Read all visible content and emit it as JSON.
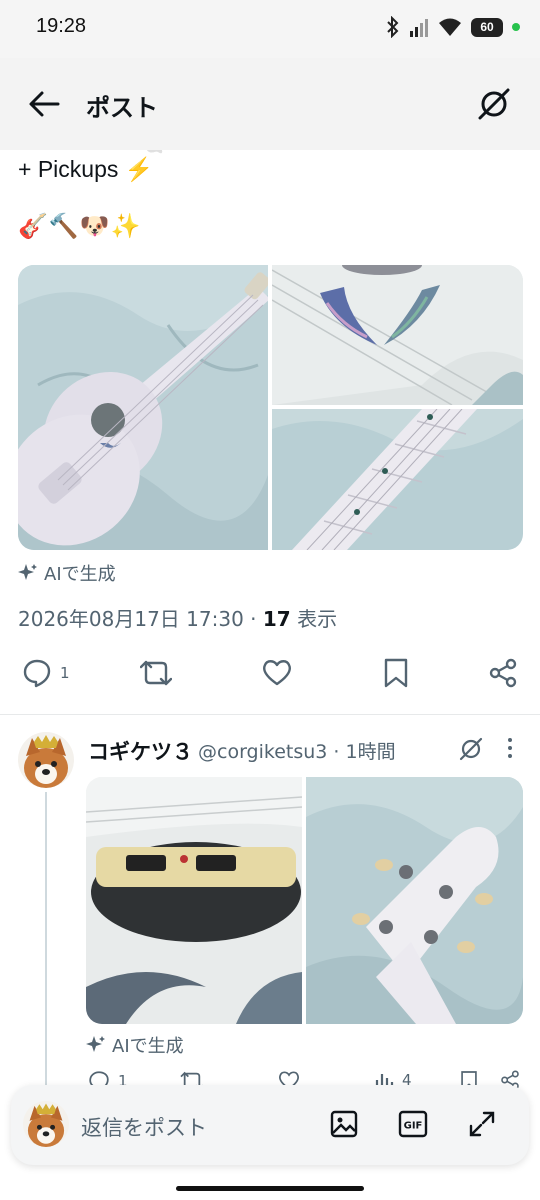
{
  "status_bar": {
    "time": "19:28",
    "battery": "60",
    "icons": [
      "bluetooth-icon",
      "signal-icon",
      "wifi-icon",
      "battery-icon",
      "green-dot-indicator"
    ]
  },
  "header": {
    "title": "ポスト",
    "back_icon": "arrow-left-icon",
    "grok_icon": "grok-icon"
  },
  "post": {
    "text_partial": "Avalon Shell 🐚",
    "text_line": "+ Pickups ⚡",
    "emoji_line": "🎸🔨🐶✨",
    "ai_label": "AIで生成",
    "timestamp": "2026年08月17日 17:30",
    "separator": " · ",
    "views_count": "17",
    "views_label": "表示",
    "actions": {
      "reply_count": "1"
    }
  },
  "reply": {
    "display_name": "コギケツ３",
    "handle_time": "@corgiketsu3 · 1時間",
    "ai_label": "AIで生成",
    "actions": {
      "reply_count": "1",
      "views_count": "4"
    }
  },
  "compose": {
    "placeholder": "返信をポスト"
  },
  "colors": {
    "secondary_text": "#536471",
    "divider": "#e7e9ea",
    "thread_line": "#cfd9de"
  }
}
